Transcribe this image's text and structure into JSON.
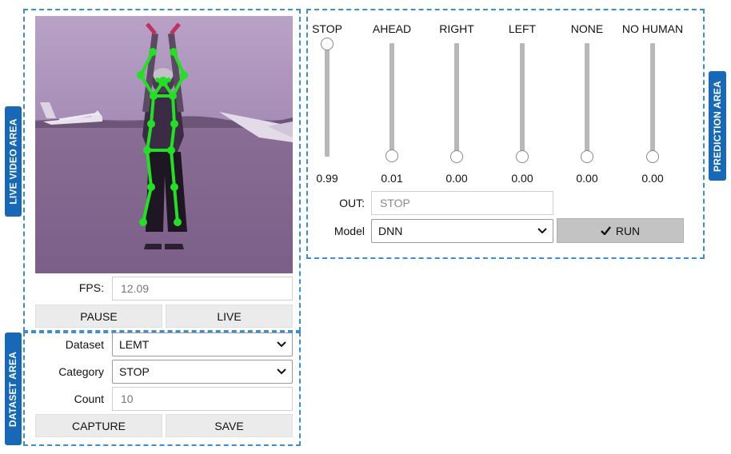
{
  "live_video_area": {
    "tab_label": "LIVE VIDEO AREA",
    "fps_label": "FPS:",
    "fps_value": "12.09",
    "pause_label": "PAUSE",
    "live_label": "LIVE"
  },
  "dataset_area": {
    "tab_label": "DATASET AREA",
    "dataset_label": "Dataset",
    "dataset_value": "LEMT",
    "category_label": "Category",
    "category_value": "STOP",
    "count_label": "Count",
    "count_value": "10",
    "capture_label": "CAPTURE",
    "save_label": "SAVE"
  },
  "prediction_area": {
    "tab_label": "PREDICTION AREA",
    "sliders": [
      {
        "label": "STOP",
        "value": "0.99",
        "level": 0.99
      },
      {
        "label": "AHEAD",
        "value": "0.01",
        "level": 0.01
      },
      {
        "label": "RIGHT",
        "value": "0.00",
        "level": 0.0
      },
      {
        "label": "LEFT",
        "value": "0.00",
        "level": 0.0
      },
      {
        "label": "NONE",
        "value": "0.00",
        "level": 0.0
      },
      {
        "label": "NO HUMAN",
        "value": "0.00",
        "level": 0.0
      }
    ],
    "out_label": "OUT:",
    "out_placeholder": "STOP",
    "model_label": "Model",
    "model_value": "DNN",
    "run_label": "RUN"
  },
  "icons": {
    "run": "check-icon",
    "select": "chevron-down-icon"
  },
  "colors": {
    "accent": "#1769b7",
    "dashed_border": "#3c8ed2",
    "skeleton": "#22e022"
  }
}
